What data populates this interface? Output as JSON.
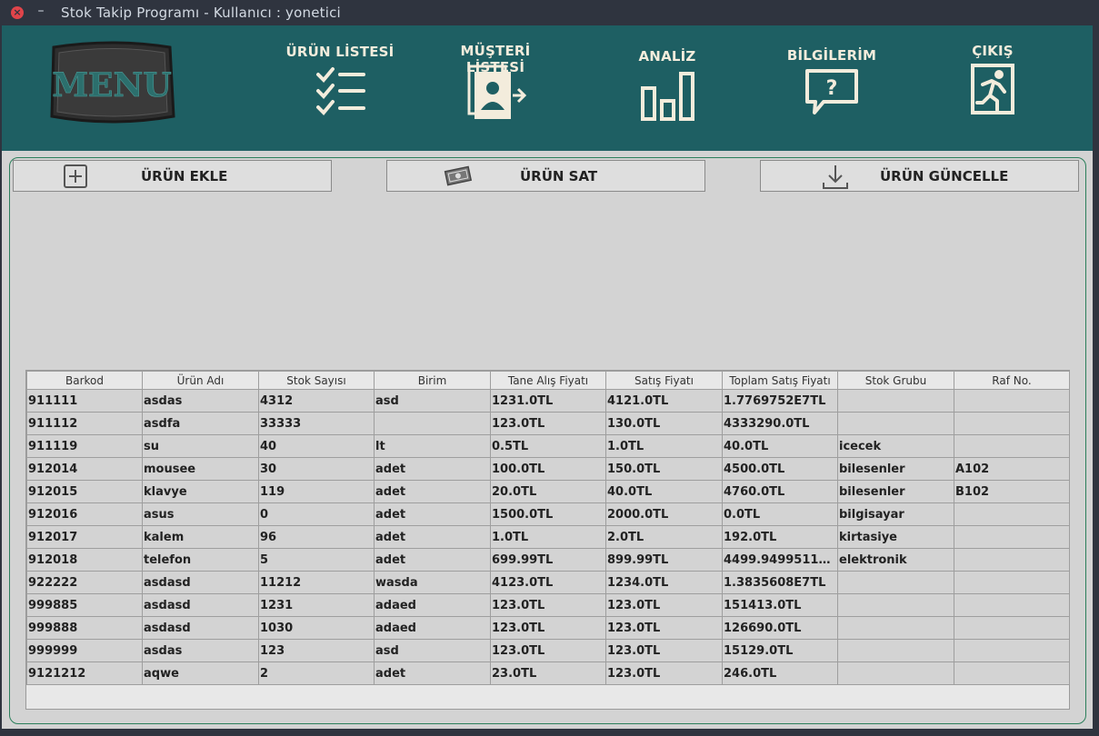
{
  "window": {
    "title": "Stok Takip Programı - Kullanıcı : yonetici",
    "close_glyph": "×",
    "minimize_glyph": "–"
  },
  "header": {
    "logo_text": "MENU",
    "nav": [
      {
        "label": "ÜRÜN LİSTESİ",
        "icon": "checklist-icon"
      },
      {
        "label": "MÜŞTERİ LİSTESİ",
        "icon": "contact-list-icon"
      },
      {
        "label": "ANALİZ",
        "icon": "bar-chart-icon"
      },
      {
        "label": "BİLGİLERİM",
        "icon": "question-bubble-icon"
      },
      {
        "label": "ÇIKIŞ",
        "icon": "exit-icon"
      }
    ]
  },
  "actions": {
    "add": {
      "label": "ÜRÜN EKLE",
      "icon": "plus-square-icon"
    },
    "sell": {
      "label": "ÜRÜN SAT",
      "icon": "money-icon"
    },
    "update": {
      "label": "ÜRÜN GÜNCELLE",
      "icon": "download-icon"
    }
  },
  "table": {
    "columns": [
      "Barkod",
      "Ürün Adı",
      "Stok Sayısı",
      "Birim",
      "Tane Alış Fiyatı",
      "Satış Fiyatı",
      "Toplam Satış Fiyatı",
      "Stok Grubu",
      "Raf No."
    ],
    "rows": [
      [
        "911111",
        "asdas",
        "4312",
        "asd",
        "1231.0TL",
        "4121.0TL",
        "1.7769752E7TL",
        "",
        ""
      ],
      [
        "911112",
        "asdfa",
        "33333",
        "",
        "123.0TL",
        "130.0TL",
        "4333290.0TL",
        "",
        ""
      ],
      [
        "911119",
        "su",
        "40",
        "lt",
        "0.5TL",
        "1.0TL",
        "40.0TL",
        "icecek",
        ""
      ],
      [
        "912014",
        "mousee",
        "30",
        "adet",
        "100.0TL",
        "150.0TL",
        "4500.0TL",
        "bilesenler",
        "A102"
      ],
      [
        "912015",
        "klavye",
        "119",
        "adet",
        "20.0TL",
        "40.0TL",
        "4760.0TL",
        "bilesenler",
        "B102"
      ],
      [
        "912016",
        "asus",
        "0",
        "adet",
        "1500.0TL",
        "2000.0TL",
        "0.0TL",
        "bilgisayar",
        ""
      ],
      [
        "912017",
        "kalem",
        "96",
        "adet",
        "1.0TL",
        "2.0TL",
        "192.0TL",
        "kirtasiye",
        ""
      ],
      [
        "912018",
        "telefon",
        "5",
        "adet",
        "699.99TL",
        "899.99TL",
        "4499.949951171...",
        "elektronik",
        ""
      ],
      [
        "922222",
        "asdasd",
        "11212",
        "wasda",
        "4123.0TL",
        "1234.0TL",
        "1.3835608E7TL",
        "",
        ""
      ],
      [
        "999885",
        "asdasd",
        "1231",
        "adaed",
        "123.0TL",
        "123.0TL",
        "151413.0TL",
        "",
        ""
      ],
      [
        "999888",
        "asdasd",
        "1030",
        "adaed",
        "123.0TL",
        "123.0TL",
        "126690.0TL",
        "",
        ""
      ],
      [
        "999999",
        "asdas",
        "123",
        "asd",
        "123.0TL",
        "123.0TL",
        "15129.0TL",
        "",
        ""
      ],
      [
        "9121212",
        "aqwe",
        "2",
        "adet",
        "23.0TL",
        "123.0TL",
        "246.0TL",
        "",
        ""
      ]
    ]
  },
  "colors": {
    "header_bg": "#1e5f63",
    "nav_fg": "#f3ecdc",
    "titlebar_bg": "#2f343f",
    "close_red": "#e0444a",
    "panel_border": "#2b7f5b"
  }
}
